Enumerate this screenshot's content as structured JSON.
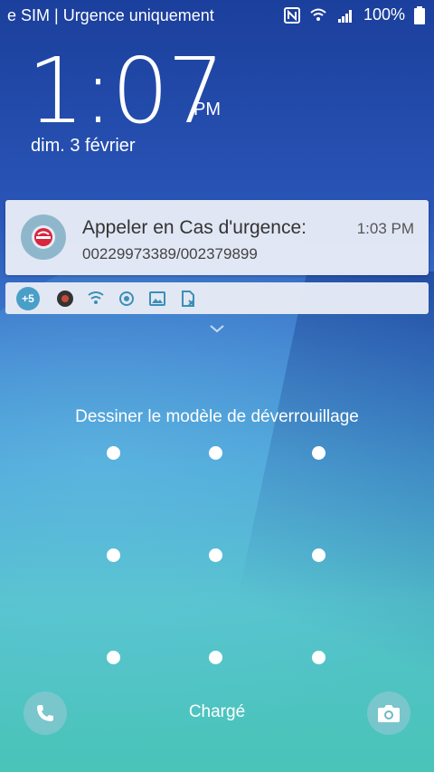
{
  "status_bar": {
    "carrier_text": "e SIM | Urgence uniquement",
    "battery_text": "100%",
    "icons": [
      "nfc-icon",
      "wifi-icon",
      "signal-icon",
      "battery-icon"
    ]
  },
  "lock": {
    "time": "1:07",
    "ampm": "PM",
    "date": "dim. 3 février"
  },
  "notification": {
    "icon": "emergency-call-icon",
    "title": "Appeler en Cas d'urgence:",
    "time": "1:03 PM",
    "body": "00229973389/002379899"
  },
  "tray": {
    "badge": "+5",
    "icons": [
      "app-icon",
      "shield-wifi-icon",
      "sync-icon",
      "image-icon",
      "sim-icon"
    ]
  },
  "pattern": {
    "hint": "Dessiner le modèle de déverrouillage",
    "dots": 9
  },
  "bottom": {
    "left_icon": "phone-icon",
    "status": "Chargé",
    "right_icon": "camera-icon"
  },
  "colors": {
    "accent": "#4a9fc9",
    "notification_bg": "#e8ecf6"
  }
}
